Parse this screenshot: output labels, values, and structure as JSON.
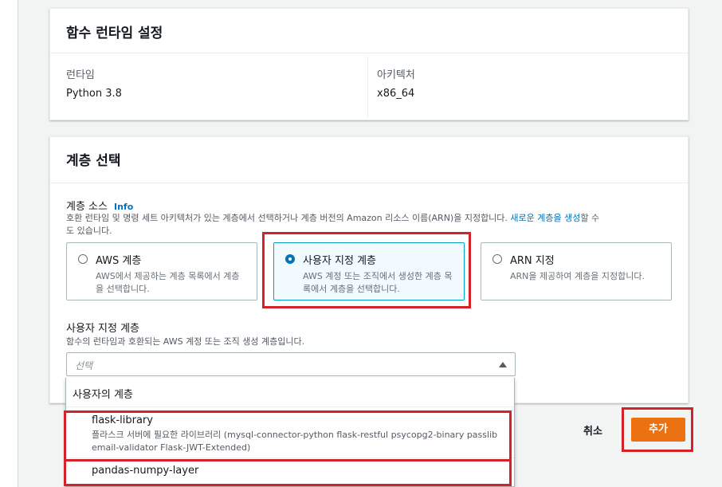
{
  "runtime_panel": {
    "title": "함수 런타임 설정",
    "runtime_label": "런타임",
    "runtime_value": "Python 3.8",
    "arch_label": "아키텍처",
    "arch_value": "x86_64"
  },
  "layer_panel": {
    "title": "계층 선택",
    "source_label": "계층 소스",
    "info": "Info",
    "source_desc_1": "호환 런타임 및 명령 세트 아키텍처가 있는 계층에서 선택하거나 계층 버전의 Amazon 리소스 이름(ARN)을 지정합니다.",
    "source_desc_link": "새로운 계층을 생성",
    "source_desc_2": "할 수",
    "source_desc_3": "도 있습니다.",
    "tiles": [
      {
        "title": "AWS 계층",
        "desc": "AWS에서 제공하는 계층 목록에서 계층을 선택합니다.",
        "selected": false
      },
      {
        "title": "사용자 지정 계층",
        "desc": "AWS 계정 또는 조직에서 생성한 계층 목록에서 계층을 선택합니다.",
        "selected": true
      },
      {
        "title": "ARN 지정",
        "desc": "ARN을 제공하여 계층을 지정합니다.",
        "selected": false
      }
    ],
    "custom_label": "사용자 지정 계층",
    "custom_desc": "함수의 런타임과 호환되는 AWS 계정 또는 조직 생성 계층입니다.",
    "select_placeholder": "선택"
  },
  "dropdown": {
    "group_label": "사용자의 계층",
    "options": [
      {
        "title": "flask-library",
        "desc": "플라스크 서버에 필요한 라이브러리 (mysql-connector-python flask-restful psycopg2-binary passlib email-validator Flask-JWT-Extended)"
      },
      {
        "title": "pandas-numpy-layer",
        "desc": ""
      }
    ]
  },
  "actions": {
    "cancel": "취소",
    "add": "추가"
  },
  "colors": {
    "accent": "#ec7211",
    "link": "#0073bb",
    "highlight": "#d3222a"
  },
  "icons": [
    "radio-icon",
    "caret-up-icon"
  ]
}
